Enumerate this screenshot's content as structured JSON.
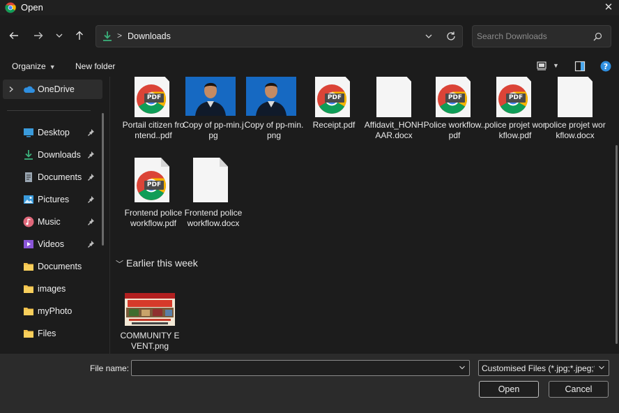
{
  "window": {
    "title": "Open",
    "close_glyph": "✕"
  },
  "nav": {
    "back_icon": "arrow-left-icon",
    "forward_icon": "arrow-right-icon",
    "recent_icon": "chevron-down-icon",
    "up_icon": "arrow-up-icon",
    "breadcrumb": [
      "Downloads"
    ],
    "breadcrumb_separator": ">",
    "search_placeholder": "Search Downloads"
  },
  "commandbar": {
    "organize_label": "Organize",
    "new_folder_label": "New folder"
  },
  "sidebar": {
    "onedrive_label": "OneDrive",
    "items": [
      {
        "label": "Desktop",
        "icon": "desktop-icon",
        "pinned": true
      },
      {
        "label": "Downloads",
        "icon": "download-icon",
        "pinned": true
      },
      {
        "label": "Documents",
        "icon": "document-icon",
        "pinned": true
      },
      {
        "label": "Pictures",
        "icon": "pictures-icon",
        "pinned": true
      },
      {
        "label": "Music",
        "icon": "music-icon",
        "pinned": true
      },
      {
        "label": "Videos",
        "icon": "videos-icon",
        "pinned": true
      },
      {
        "label": "Documents",
        "icon": "folder-icon",
        "pinned": false
      },
      {
        "label": "images",
        "icon": "folder-icon",
        "pinned": false
      },
      {
        "label": "myPhoto",
        "icon": "folder-icon",
        "pinned": false
      },
      {
        "label": "Files",
        "icon": "folder-icon",
        "pinned": false
      }
    ]
  },
  "files": {
    "row1": [
      {
        "name": "Portail citizen frontend..pdf",
        "type": "pdf"
      },
      {
        "name": "Copy of pp-min.jpg",
        "type": "photo"
      },
      {
        "name": "Copy of pp-min.png",
        "type": "photo"
      },
      {
        "name": "Receipt.pdf",
        "type": "pdf"
      },
      {
        "name": "Affidavit_HONHAAR.docx",
        "type": "doc"
      },
      {
        "name": "Police workflow..pdf",
        "type": "pdf"
      },
      {
        "name": "police projet workflow.pdf",
        "type": "pdf"
      },
      {
        "name": "police projet workflow.docx",
        "type": "doc"
      }
    ],
    "row2": [
      {
        "name": "Frontend police workflow.pdf",
        "type": "pdf"
      },
      {
        "name": "Frontend police workflow.docx",
        "type": "doc"
      }
    ],
    "group_earlier": "Earlier this week",
    "earlier": [
      {
        "name": "COMMUNITY EVENT.png",
        "type": "image"
      }
    ],
    "pdf_badge": "PDF"
  },
  "footer": {
    "filename_label": "File name:",
    "filename_value": "",
    "filter_value": "Customised Files (*.jpg;*.jpeg;*",
    "open_label": "Open",
    "cancel_label": "Cancel"
  },
  "colors": {
    "background": "#1c1c1c",
    "footer": "#2b2b2b",
    "downloads_green": "#3bb07b",
    "onedrive_blue": "#2f8fe0"
  }
}
